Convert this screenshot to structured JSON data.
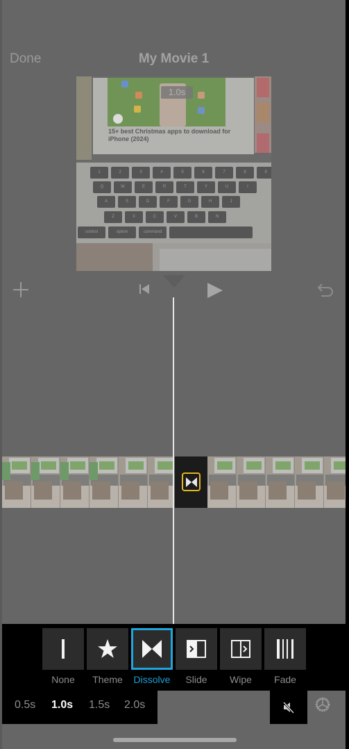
{
  "nav": {
    "done_label": "Done",
    "title": "My Movie 1"
  },
  "preview": {
    "time_badge": "1.0s",
    "article_title": "15+ best Christmas apps to download for iPhone (2024)",
    "keyboard_rows": [
      [
        "1",
        "2",
        "3",
        "4",
        "5",
        "6",
        "7",
        "8",
        "9"
      ],
      [
        "Q",
        "W",
        "E",
        "R",
        "T",
        "Y",
        "U",
        "I"
      ],
      [
        "A",
        "S",
        "D",
        "F",
        "G",
        "H",
        "J"
      ],
      [
        "Z",
        "X",
        "C",
        "V",
        "B",
        "N"
      ]
    ],
    "modifier_keys": [
      "control",
      "option",
      "command"
    ]
  },
  "toolbar": {
    "add_icon": "plus-icon",
    "skip_icon": "skip-to-start-icon",
    "play_icon": "play-icon",
    "undo_icon": "undo-icon"
  },
  "timeline": {
    "clip_a_thumbs": 6,
    "clip_b_thumbs": 5,
    "transition_icon": "dissolve-icon",
    "transition_color": "#e2b71d"
  },
  "transitions": {
    "items": [
      {
        "label": "None",
        "icon": "none-icon"
      },
      {
        "label": "Theme",
        "icon": "star-icon"
      },
      {
        "label": "Dissolve",
        "icon": "dissolve-icon",
        "selected": true
      },
      {
        "label": "Slide",
        "icon": "slide-icon"
      },
      {
        "label": "Wipe",
        "icon": "wipe-icon"
      },
      {
        "label": "Fade",
        "icon": "fade-icon"
      }
    ],
    "selected_color": "#1fa6dc"
  },
  "durations": {
    "options": [
      "0.5s",
      "1.0s",
      "1.5s",
      "2.0s"
    ],
    "selected": "1.0s"
  },
  "controls": {
    "mute_icon": "speaker-muted-icon",
    "settings_icon": "gear-icon"
  }
}
